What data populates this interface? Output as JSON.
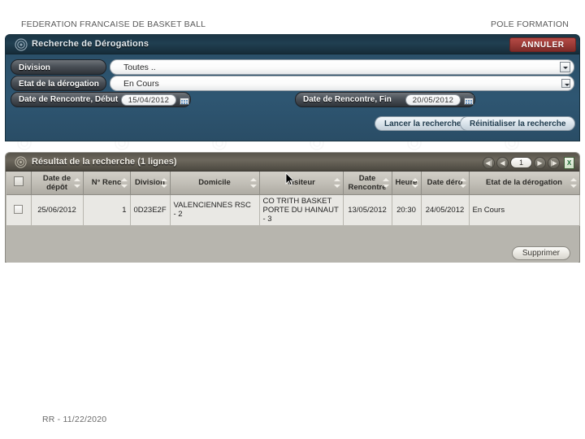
{
  "slide": {
    "header_left": "FEDERATION FRANCAISE DE BASKET BALL",
    "header_right": "POLE FORMATION",
    "footer": "RR - 11/22/2020"
  },
  "search_panel": {
    "title": "Recherche de Dérogations",
    "gear_icon": "gear-icon",
    "cancel_button": "ANNULER",
    "fields": {
      "division_label": "Division",
      "division_value": "Toutes ..",
      "etat_label": "Etat de la dérogation",
      "etat_value": "En Cours",
      "date_debut_label": "Date de Rencontre, Début",
      "date_debut_value": "15/04/2012",
      "date_fin_label": "Date de Rencontre, Fin",
      "date_fin_value": "20/05/2012",
      "calendar_icon": "calendar-icon",
      "dropdown_icon": "chevron-down-icon"
    },
    "actions": {
      "search_button": "Lancer la recherche",
      "reset_button": "Réinitialiser la recherche"
    }
  },
  "result_panel": {
    "title": "Résultat de la recherche (1 lignes)",
    "gear_icon": "gear-icon",
    "pager": {
      "first": "◀|",
      "prev": "◀",
      "page": "1",
      "next": "▶",
      "last": "|▶",
      "export_icon": "excel-export-icon"
    },
    "columns": [
      {
        "label": "",
        "key": "select"
      },
      {
        "label": "Date de dépôt",
        "key": "date_depot"
      },
      {
        "label": "N° Renc",
        "key": "num_renc"
      },
      {
        "label": "Division",
        "key": "division"
      },
      {
        "label": "Domicile",
        "key": "domicile"
      },
      {
        "label": "Visiteur",
        "key": "visiteur"
      },
      {
        "label": "Date Rencontre",
        "key": "date_rencontre"
      },
      {
        "label": "Heure",
        "key": "heure"
      },
      {
        "label": "Date déro",
        "key": "date_dero"
      },
      {
        "label": "Etat de la dérogation",
        "key": "etat"
      }
    ],
    "rows": [
      {
        "date_depot": "25/06/2012",
        "num_renc": "1",
        "division": "0D23E2F",
        "domicile": "VALENCIENNES RSC - 2",
        "visiteur": "CO TRITH BASKET PORTE DU HAINAUT - 3",
        "date_rencontre": "13/05/2012",
        "heure": "20:30",
        "date_dero": "24/05/2012",
        "etat": "En Cours"
      }
    ],
    "delete_button": "Supprimer"
  },
  "colors": {
    "search_panel_bg": "#2e5672",
    "search_title_bg": "#1b3544",
    "cancel_red": "#9d3b37",
    "result_panel_bg": "#b7b5ae",
    "result_title_bg": "#58544b",
    "table_header_bg": "#c2bfb7",
    "table_cell_bg": "#e9e8e4"
  }
}
